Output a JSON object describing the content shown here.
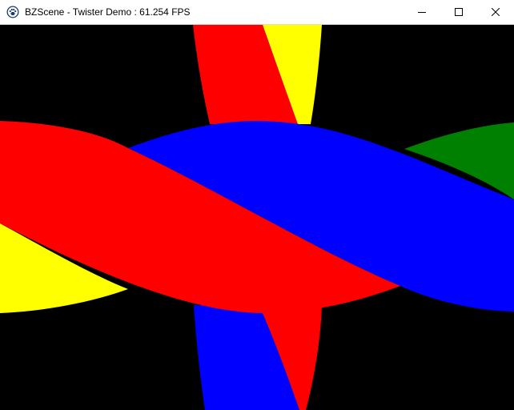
{
  "window": {
    "title": "BZScene - Twister Demo : 61.254 FPS",
    "app_icon": "paw-icon",
    "controls": {
      "minimize_icon": "minimize-icon",
      "maximize_icon": "maximize-icon",
      "close_icon": "close-icon"
    }
  },
  "scene": {
    "background_color": "#000000",
    "ribbon_colors": {
      "red": "#ff0000",
      "blue": "#0000ff",
      "yellow": "#ffff00",
      "green": "#008000"
    }
  }
}
